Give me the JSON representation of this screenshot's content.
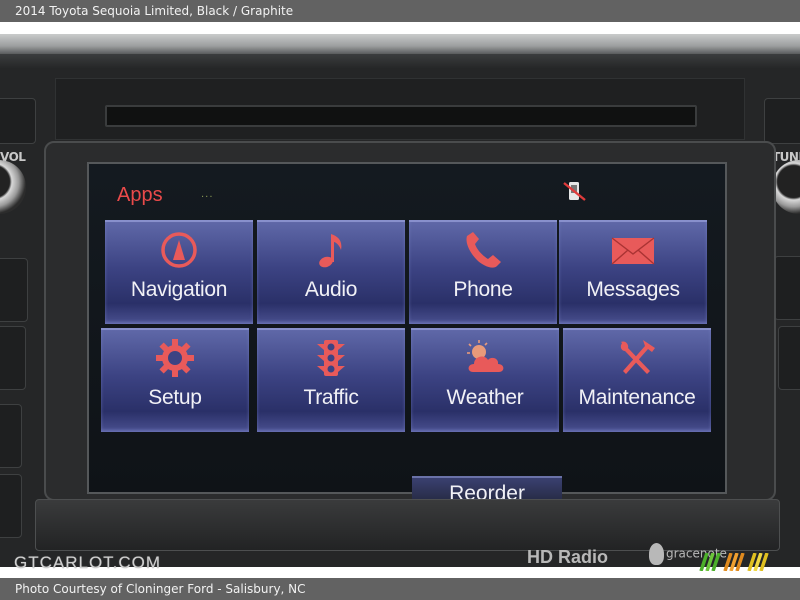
{
  "header": {
    "caption": "2014 Toyota Sequoia Limited,  Black / Graphite"
  },
  "footer": {
    "credit": "Photo Courtesy of Cloninger Ford - Salisbury, NC"
  },
  "watermark": "GTCARLOT.COM",
  "console": {
    "left_knob_label": "VOL",
    "right_knob_label": "TUNE",
    "hd_radio_label": "HD Radio",
    "gracenote_label": "gracenote"
  },
  "screen": {
    "title": "Apps",
    "title_color": "#ea4a4a",
    "status_icon": "phone-disconnected-icon",
    "tiles": [
      {
        "label": "Navigation",
        "icon": "compass-icon"
      },
      {
        "label": "Audio",
        "icon": "music-note-icon"
      },
      {
        "label": "Phone",
        "icon": "phone-handset-icon"
      },
      {
        "label": "Messages",
        "icon": "envelope-icon"
      },
      {
        "label": "Setup",
        "icon": "gear-icon"
      },
      {
        "label": "Traffic",
        "icon": "traffic-light-icon"
      },
      {
        "label": "Weather",
        "icon": "sun-cloud-icon"
      },
      {
        "label": "Maintenance",
        "icon": "wrench-hammer-icon"
      }
    ],
    "reorder_label": "Reorder",
    "icon_color": "#e85a5a",
    "tile_color": "#3c4383"
  }
}
